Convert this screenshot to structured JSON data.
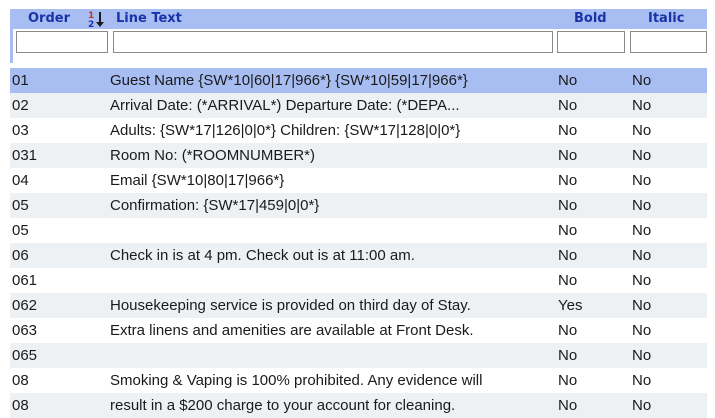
{
  "columns": {
    "order": "Order",
    "line_text": "Line Text",
    "bold": "Bold",
    "italic": "Italic"
  },
  "filters": {
    "order": "",
    "line_text": "",
    "bold": "",
    "italic": ""
  },
  "rows": [
    {
      "order": "01",
      "text": "Guest Name {SW*10|60|17|966*} {SW*10|59|17|966*}",
      "bold": "No",
      "italic": "No"
    },
    {
      "order": "02",
      "text": "Arrival Date: (*ARRIVAL*) Departure Date: (*DEPA...",
      "bold": "No",
      "italic": "No"
    },
    {
      "order": "03",
      "text": "Adults: {SW*17|126|0|0*} Children: {SW*17|128|0|0*}",
      "bold": "No",
      "italic": "No"
    },
    {
      "order": "031",
      "text": "Room No: (*ROOMNUMBER*)",
      "bold": "No",
      "italic": "No"
    },
    {
      "order": "04",
      "text": "Email {SW*10|80|17|966*}",
      "bold": "No",
      "italic": "No"
    },
    {
      "order": "05",
      "text": "Confirmation: {SW*17|459|0|0*}",
      "bold": "No",
      "italic": "No"
    },
    {
      "order": "05",
      "text": "",
      "bold": "No",
      "italic": "No"
    },
    {
      "order": "06",
      "text": "Check in is at 4 pm. Check out is at 11:00 am.",
      "bold": "No",
      "italic": "No"
    },
    {
      "order": "061",
      "text": "",
      "bold": "No",
      "italic": "No"
    },
    {
      "order": "062",
      "text": "Housekeeping service is provided on third day of Stay.",
      "bold": "Yes",
      "italic": "No"
    },
    {
      "order": "063",
      "text": "Extra linens and amenities are available at Front Desk.",
      "bold": "No",
      "italic": "No"
    },
    {
      "order": "065",
      "text": "",
      "bold": "No",
      "italic": "No"
    },
    {
      "order": "08",
      "text": "Smoking & Vaping is 100% prohibited. Any evidence will",
      "bold": "No",
      "italic": "No"
    },
    {
      "order": "08",
      "text": "result in a $200 charge to your account for cleaning.",
      "bold": "No",
      "italic": "No"
    }
  ],
  "colors": {
    "header_bg": "#a8bef3",
    "header_text": "#1a33a8",
    "selected_row": "#a8bef3",
    "alt_row": "#eef1f4"
  },
  "icons": {
    "sort": "sort-descending-icon"
  }
}
